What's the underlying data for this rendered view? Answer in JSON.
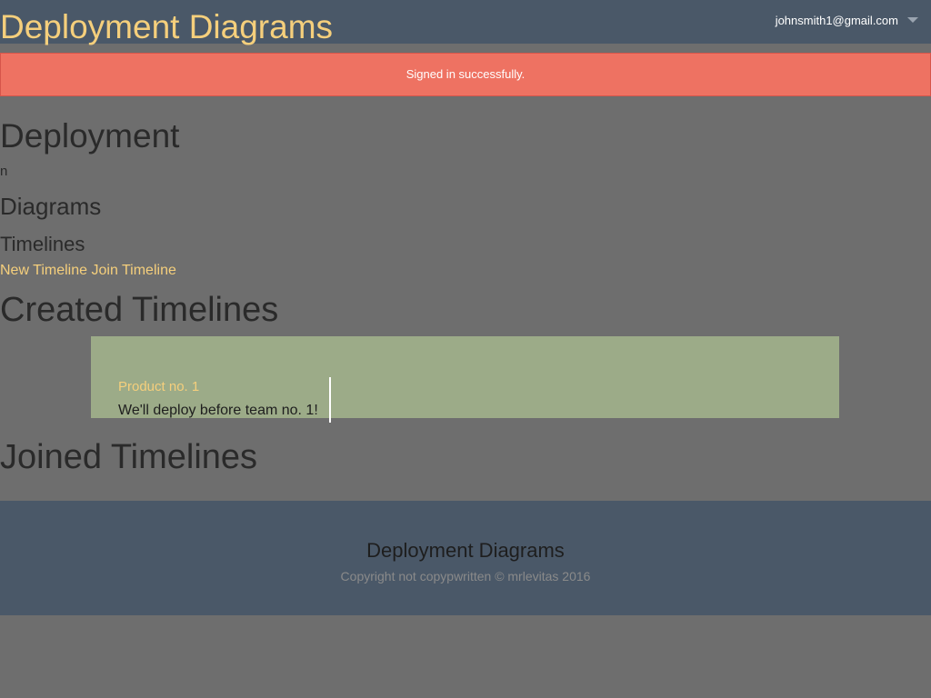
{
  "header": {
    "brand": "Deployment Diagrams",
    "user_email": "johnsmith1@gmail.com",
    "user_menu_icon": "caret-down-icon"
  },
  "flash": {
    "message": "Signed in successfully."
  },
  "main": {
    "heading_deployment": "Deployment",
    "stray_text": "n",
    "heading_diagrams": "Diagrams",
    "heading_timelines": "Timelines",
    "links": {
      "new_timeline": "New Timeline",
      "join_timeline": "Join Timeline"
    },
    "created_heading": "Created Timelines",
    "created_timelines": [
      {
        "title": "Product no. 1",
        "description": "We'll deploy before team no. 1!"
      }
    ],
    "joined_heading": "Joined Timelines"
  },
  "footer": {
    "title": "Deployment Diagrams",
    "copyright": "Copyright not copypwritten © mrlevitas 2016"
  },
  "colors": {
    "navbar": "#4a5868",
    "background": "#6e6e6e",
    "accent": "#f5cf7c",
    "flash": "#ee7262",
    "card_area": "#9cab88"
  }
}
